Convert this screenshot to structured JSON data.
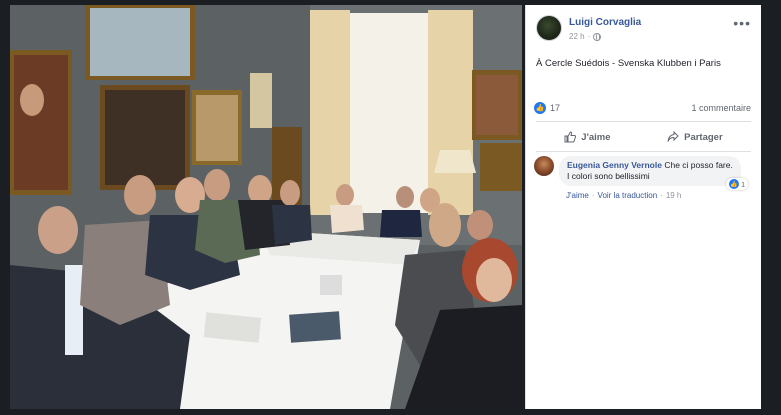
{
  "post": {
    "author": "Luigi Corvaglia",
    "time": "22 h",
    "more": "•••",
    "text": "À Cercle Suédois - Svenska Klubben i Paris"
  },
  "stats": {
    "likes": "17",
    "comments": "1 commentaire"
  },
  "actions": {
    "like": "J'aime",
    "share": "Partager"
  },
  "comment": {
    "author": "Eugenia Genny Vernole",
    "text": "Che ci posso fare. I colori sono bellissimi",
    "reactions": "1",
    "like": "J'aime",
    "translate": "Voir la traduction",
    "time": "19 h"
  },
  "colors": {
    "link": "#385898",
    "like_blue": "#2078f4",
    "muted": "#90949c"
  }
}
